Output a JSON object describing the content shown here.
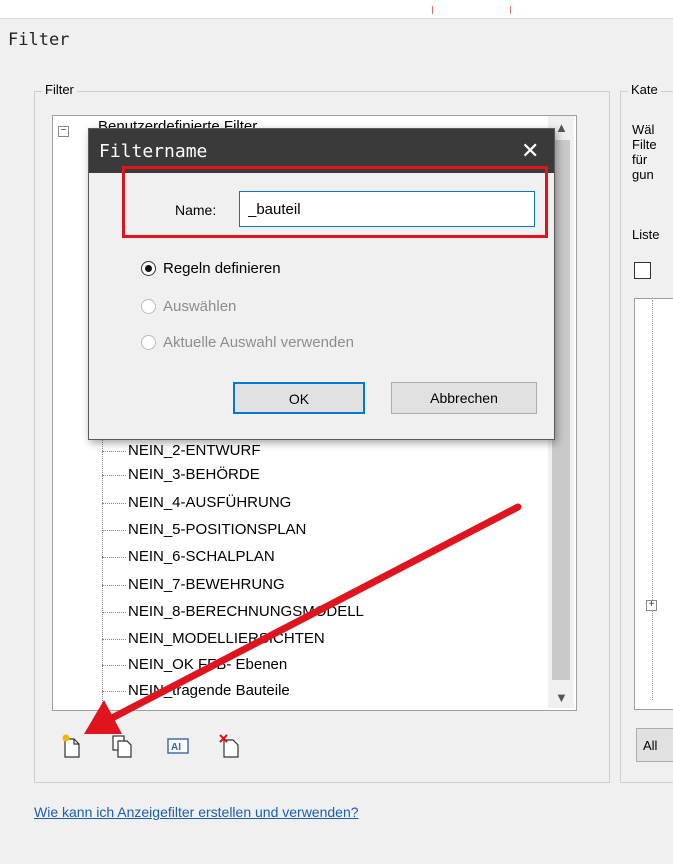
{
  "page": {
    "title": "Filter"
  },
  "filter_group": {
    "label": "Filter",
    "partial_item": "Benutzerdefinierte Filter",
    "items": [
      "NEIN_2-ENTWURF",
      "NEIN_3-BEHÖRDE",
      "NEIN_4-AUSFÜHRUNG",
      "NEIN_5-POSITIONSPLAN",
      "NEIN_6-SCHALPLAN",
      "NEIN_7-BEWEHRUNG",
      "NEIN_8-BERECHNUNGSMODELL",
      "NEIN_MODELLIERSICHTEN",
      "NEIN_OK FFB- Ebenen",
      "NEIN_tragende Bauteile"
    ],
    "toolbar_icons": [
      "new-filter-icon",
      "duplicate-filter-icon",
      "rename-filter-icon",
      "delete-filter-icon"
    ]
  },
  "help_link": "Wie kann ich Anzeigefilter erstellen und verwenden?",
  "category_group": {
    "label": "Kate",
    "text_lines": [
      "Wäl",
      "Filte",
      "für",
      "gun"
    ],
    "list_label": "Liste",
    "bottom_button": "All"
  },
  "dialog": {
    "title": "Filtername",
    "name_label": "Name:",
    "name_value": "_bauteil",
    "radio_options": [
      {
        "label": "Regeln definieren",
        "selected": true,
        "enabled": true
      },
      {
        "label": "Auswählen",
        "selected": false,
        "enabled": false
      },
      {
        "label": "Aktuelle Auswahl verwenden",
        "selected": false,
        "enabled": false
      }
    ],
    "ok_label": "OK",
    "cancel_label": "Abbrechen"
  },
  "colors": {
    "highlight_box": "#e0141e",
    "arrow": "#e0141e",
    "focus_border": "#0078d7",
    "titlebar": "#3a3a3a",
    "link": "#1a5fb4"
  }
}
